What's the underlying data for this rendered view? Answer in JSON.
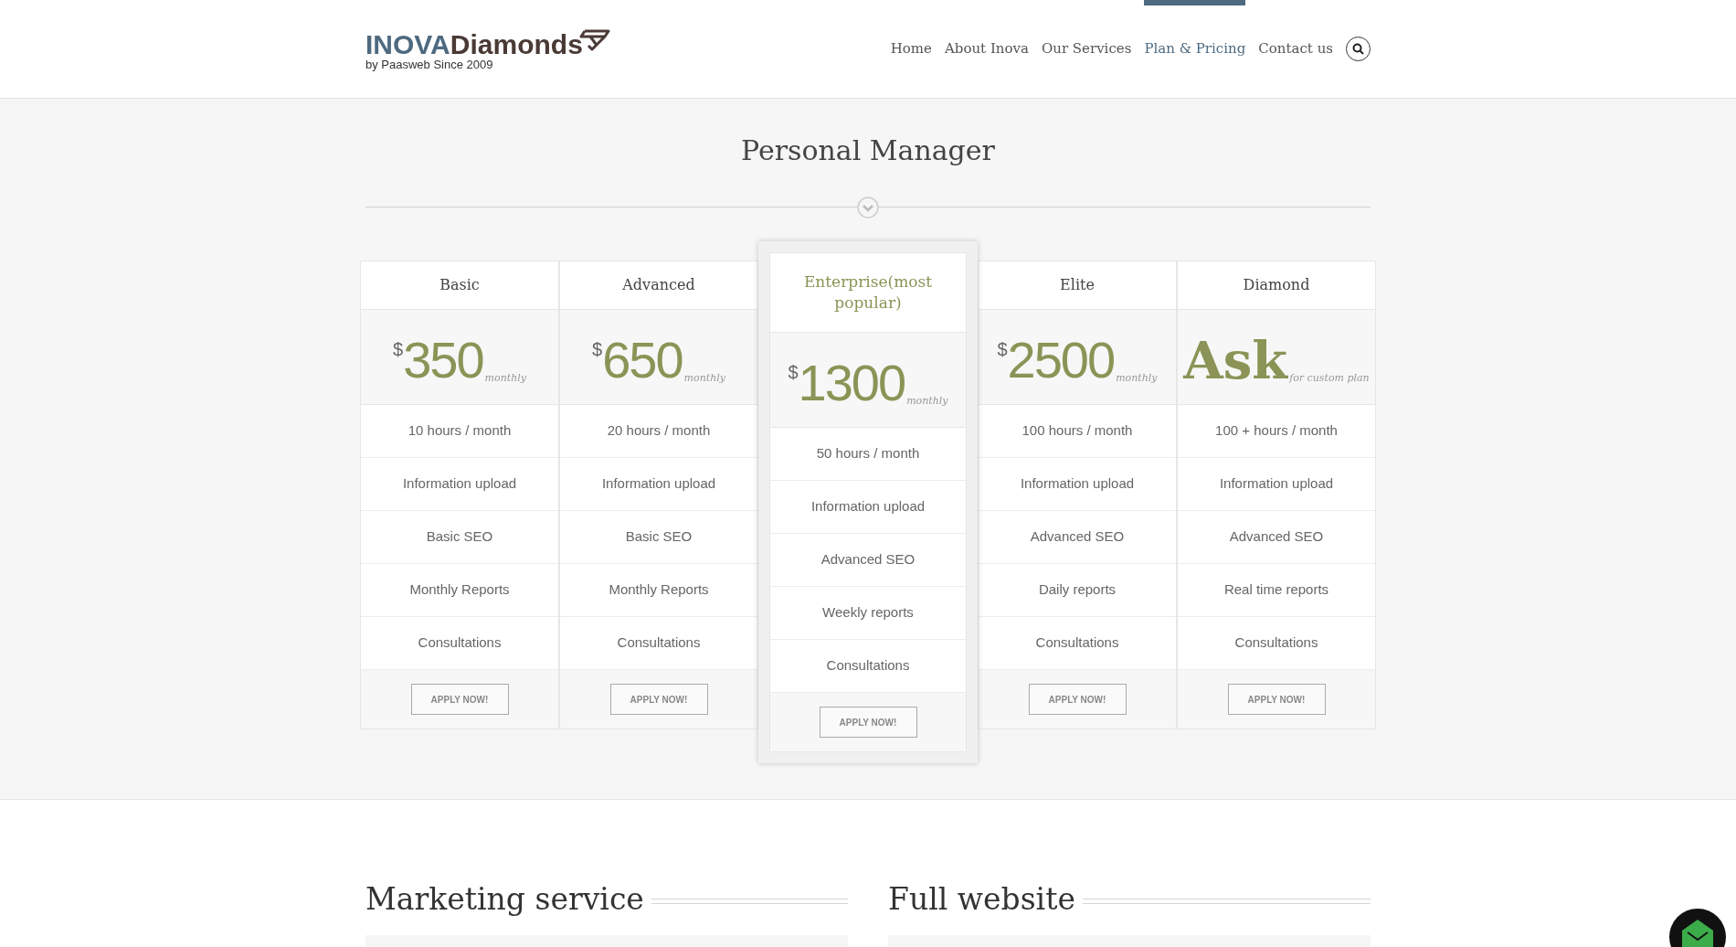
{
  "logo": {
    "brand_first": "INOVA",
    "brand_second": "Diamonds",
    "tagline": "by Paasweb Since 2009"
  },
  "nav": [
    {
      "label": "Home",
      "selected": false
    },
    {
      "label": "About Inova",
      "selected": false
    },
    {
      "label": "Our Services",
      "selected": false
    },
    {
      "label": "Plan & Pricing",
      "selected": true
    },
    {
      "label": "Contact us",
      "selected": false
    }
  ],
  "page_title": "Personal Manager",
  "plans": [
    {
      "name": "Basic",
      "featured": false,
      "currency": "$",
      "price": "350",
      "period": "monthly",
      "features": [
        "10 hours / month",
        "Information upload",
        "Basic SEO",
        "Monthly Reports",
        "Consultations"
      ],
      "button": "APPLY NOW!"
    },
    {
      "name": "Advanced",
      "featured": false,
      "currency": "$",
      "price": "650",
      "period": "monthly",
      "features": [
        "20 hours / month",
        "Information upload",
        "Basic SEO",
        "Monthly Reports",
        "Consultations"
      ],
      "button": "APPLY NOW!"
    },
    {
      "name": "Enterprise(most popular)",
      "featured": true,
      "currency": "$",
      "price": "1300",
      "period": "monthly",
      "features": [
        "50 hours / month",
        "Information upload",
        "Advanced SEO",
        "Weekly reports",
        "Consultations"
      ],
      "button": "APPLY NOW!"
    },
    {
      "name": "Elite",
      "featured": false,
      "currency": "$",
      "price": "2500",
      "period": "monthly",
      "features": [
        "100 hours / month",
        "Information upload",
        "Advanced SEO",
        "Daily reports",
        "Consultations"
      ],
      "button": "APPLY NOW!"
    },
    {
      "name": "Diamond",
      "featured": false,
      "price": "Ask",
      "period": "for custom plan",
      "features": [
        "100 + hours / month",
        "Information upload",
        "Advanced SEO",
        "Real time reports",
        "Consultations"
      ],
      "button": "APPLY NOW!"
    }
  ],
  "sections": [
    "Marketing service",
    "Full website"
  ]
}
